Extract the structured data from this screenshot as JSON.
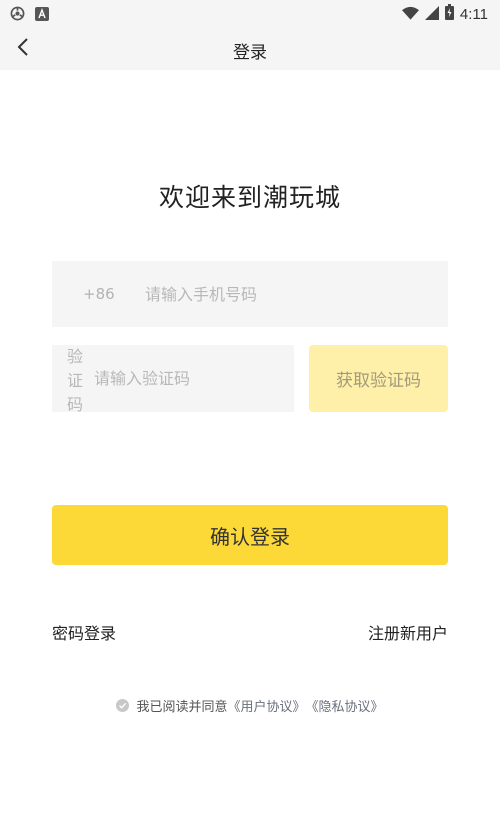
{
  "status_bar": {
    "time": "4:11",
    "left_icons": [
      "sync-icon",
      "a-letter-icon"
    ],
    "right_icons": [
      "wifi-icon",
      "signal-icon",
      "battery-icon"
    ]
  },
  "nav": {
    "title": "登录",
    "back_icon": "chevron-left-icon"
  },
  "welcome_title": "欢迎来到潮玩城",
  "phone": {
    "country_code": "+86",
    "placeholder": "请输入手机号码",
    "value": ""
  },
  "verify": {
    "label": "验证码",
    "placeholder": "请输入验证码",
    "value": "",
    "get_code_label": "获取验证码"
  },
  "confirm_label": "确认登录",
  "links": {
    "password_login": "密码登录",
    "register": "注册新用户"
  },
  "agreement": {
    "prefix": "我已阅读并同意",
    "user_agreement": "《用户协议》",
    "privacy_policy": "《隐私协议》"
  },
  "colors": {
    "accent": "#fcd937",
    "accent_light": "#fef0a8",
    "field_bg": "#f5f5f5",
    "nav_bg": "#f5f5f5"
  }
}
